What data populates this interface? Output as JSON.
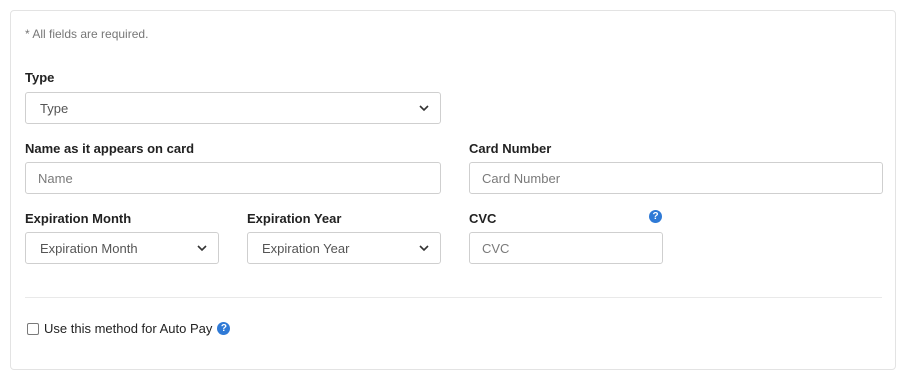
{
  "form": {
    "required_note": "* All fields are required.",
    "type": {
      "label": "Type",
      "selected": "Type"
    },
    "name": {
      "label": "Name as it appears on card",
      "placeholder": "Name"
    },
    "card_number": {
      "label": "Card Number",
      "placeholder": "Card Number"
    },
    "exp_month": {
      "label": "Expiration Month",
      "selected": "Expiration Month"
    },
    "exp_year": {
      "label": "Expiration Year",
      "selected": "Expiration Year"
    },
    "cvc": {
      "label": "CVC",
      "placeholder": "CVC",
      "help_icon": "question-circle-icon"
    },
    "autopay": {
      "label": "Use this method for Auto Pay",
      "checked": false,
      "help_icon": "question-circle-icon"
    }
  },
  "colors": {
    "accent": "#2f7ad6",
    "border": "#cfcfcf",
    "muted_text": "#777777"
  }
}
